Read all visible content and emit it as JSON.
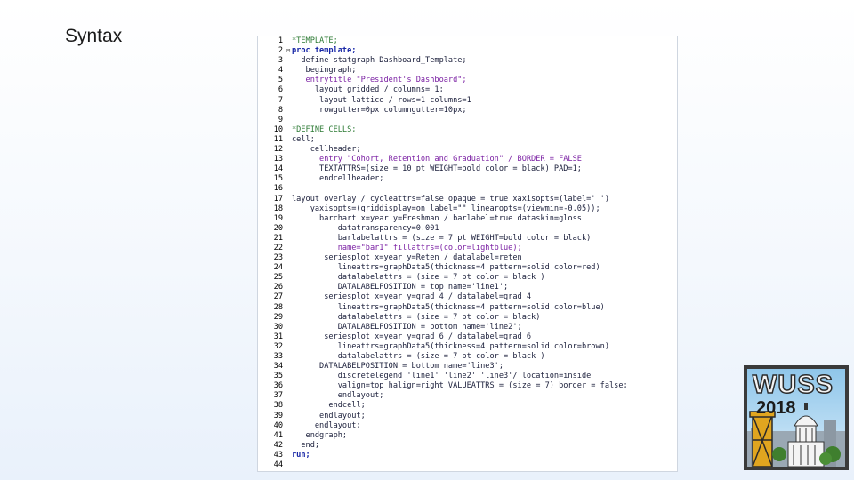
{
  "slide": {
    "title": "Syntax"
  },
  "code": [
    {
      "n": "1",
      "fold": "",
      "text": "*TEMPLATE;",
      "kind": "comment"
    },
    {
      "n": "2",
      "fold": "⊟",
      "text": "proc template;",
      "kind": "keyword"
    },
    {
      "n": "3",
      "fold": "",
      "text": "  define statgraph Dashboard_Template;",
      "kind": "plain"
    },
    {
      "n": "4",
      "fold": "",
      "text": "   begingraph;",
      "kind": "plain"
    },
    {
      "n": "5",
      "fold": "",
      "text": "   entrytitle \"President's Dashboard\";",
      "kind": "string"
    },
    {
      "n": "6",
      "fold": "",
      "text": "     layout gridded / columns= 1;",
      "kind": "plain"
    },
    {
      "n": "7",
      "fold": "",
      "text": "      layout lattice / rows=1 columns=1",
      "kind": "plain"
    },
    {
      "n": "8",
      "fold": "",
      "text": "      rowgutter=0px columngutter=10px;",
      "kind": "plain"
    },
    {
      "n": "9",
      "fold": "",
      "text": "",
      "kind": "plain"
    },
    {
      "n": "10",
      "fold": "",
      "text": "*DEFINE CELLS;",
      "kind": "comment"
    },
    {
      "n": "11",
      "fold": "",
      "text": "cell;",
      "kind": "plain"
    },
    {
      "n": "12",
      "fold": "",
      "text": "    cellheader;",
      "kind": "plain"
    },
    {
      "n": "13",
      "fold": "",
      "text": "      entry \"Cohort, Retention and Graduation\" / BORDER = FALSE",
      "kind": "string"
    },
    {
      "n": "14",
      "fold": "",
      "text": "      TEXTATTRS=(size = 10 pt WEIGHT=bold color = black) PAD=1;",
      "kind": "plain"
    },
    {
      "n": "15",
      "fold": "",
      "text": "      endcellheader;",
      "kind": "plain"
    },
    {
      "n": "16",
      "fold": "",
      "text": "",
      "kind": "plain"
    },
    {
      "n": "17",
      "fold": "",
      "text": "layout overlay / cycleattrs=false opaque = true xaxisopts=(label=' ')",
      "kind": "plain"
    },
    {
      "n": "18",
      "fold": "",
      "text": "    yaxisopts=(griddisplay=on label=\"\" linearopts=(viewmin=-0.05));",
      "kind": "plain"
    },
    {
      "n": "19",
      "fold": "",
      "text": "      barchart x=year y=Freshman / barlabel=true dataskin=gloss",
      "kind": "plain"
    },
    {
      "n": "20",
      "fold": "",
      "text": "          datatransparency=0.001",
      "kind": "plain"
    },
    {
      "n": "21",
      "fold": "",
      "text": "          barlabelattrs = (size = 7 pt WEIGHT=bold color = black)",
      "kind": "plain"
    },
    {
      "n": "22",
      "fold": "",
      "text": "          name=\"bar1\" fillattrs=(color=lightblue);",
      "kind": "string"
    },
    {
      "n": "23",
      "fold": "",
      "text": "       seriesplot x=year y=Reten / datalabel=reten",
      "kind": "plain"
    },
    {
      "n": "24",
      "fold": "",
      "text": "          lineattrs=graphData5(thickness=4 pattern=solid color=red)",
      "kind": "plain"
    },
    {
      "n": "25",
      "fold": "",
      "text": "          datalabelattrs = (size = 7 pt color = black )",
      "kind": "plain"
    },
    {
      "n": "26",
      "fold": "",
      "text": "          DATALABELPOSITION = top name='line1';",
      "kind": "plain"
    },
    {
      "n": "27",
      "fold": "",
      "text": "       seriesplot x=year y=grad_4 / datalabel=grad_4",
      "kind": "plain"
    },
    {
      "n": "28",
      "fold": "",
      "text": "          lineattrs=graphData5(thickness=4 pattern=solid color=blue)",
      "kind": "plain"
    },
    {
      "n": "29",
      "fold": "",
      "text": "          datalabelattrs = (size = 7 pt color = black)",
      "kind": "plain"
    },
    {
      "n": "30",
      "fold": "",
      "text": "          DATALABELPOSITION = bottom name='line2';",
      "kind": "plain"
    },
    {
      "n": "31",
      "fold": "",
      "text": "       seriesplot x=year y=grad_6 / datalabel=grad_6",
      "kind": "plain"
    },
    {
      "n": "32",
      "fold": "",
      "text": "          lineattrs=graphData5(thickness=4 pattern=solid color=brown)",
      "kind": "plain"
    },
    {
      "n": "33",
      "fold": "",
      "text": "          datalabelattrs = (size = 7 pt color = black )",
      "kind": "plain"
    },
    {
      "n": "34",
      "fold": "",
      "text": "      DATALABELPOSITION = bottom name='line3';",
      "kind": "plain"
    },
    {
      "n": "35",
      "fold": "",
      "text": "          discretelegend 'line1' 'line2' 'line3'/ location=inside",
      "kind": "plain"
    },
    {
      "n": "36",
      "fold": "",
      "text": "          valign=top halign=right VALUEATTRS = (size = 7) border = false;",
      "kind": "plain"
    },
    {
      "n": "37",
      "fold": "",
      "text": "          endlayout;",
      "kind": "plain"
    },
    {
      "n": "38",
      "fold": "",
      "text": "        endcell;",
      "kind": "plain"
    },
    {
      "n": "39",
      "fold": "",
      "text": "      endlayout;",
      "kind": "plain"
    },
    {
      "n": "40",
      "fold": "",
      "text": "     endlayout;",
      "kind": "plain"
    },
    {
      "n": "41",
      "fold": "",
      "text": "   endgraph;",
      "kind": "plain"
    },
    {
      "n": "42",
      "fold": "",
      "text": "  end;",
      "kind": "plain"
    },
    {
      "n": "43",
      "fold": "",
      "text": "run;",
      "kind": "keyword"
    },
    {
      "n": "44",
      "fold": "",
      "text": "",
      "kind": "plain"
    }
  ],
  "logo": {
    "word": "WUSS",
    "year": "2018",
    "icon": "wuss-2018-logo-icon"
  },
  "colors": {
    "code_text": "#1b1f3b",
    "comment": "#2c7a34",
    "logo_frame": "#3a3a3a",
    "sky": "#8fc6ea"
  }
}
